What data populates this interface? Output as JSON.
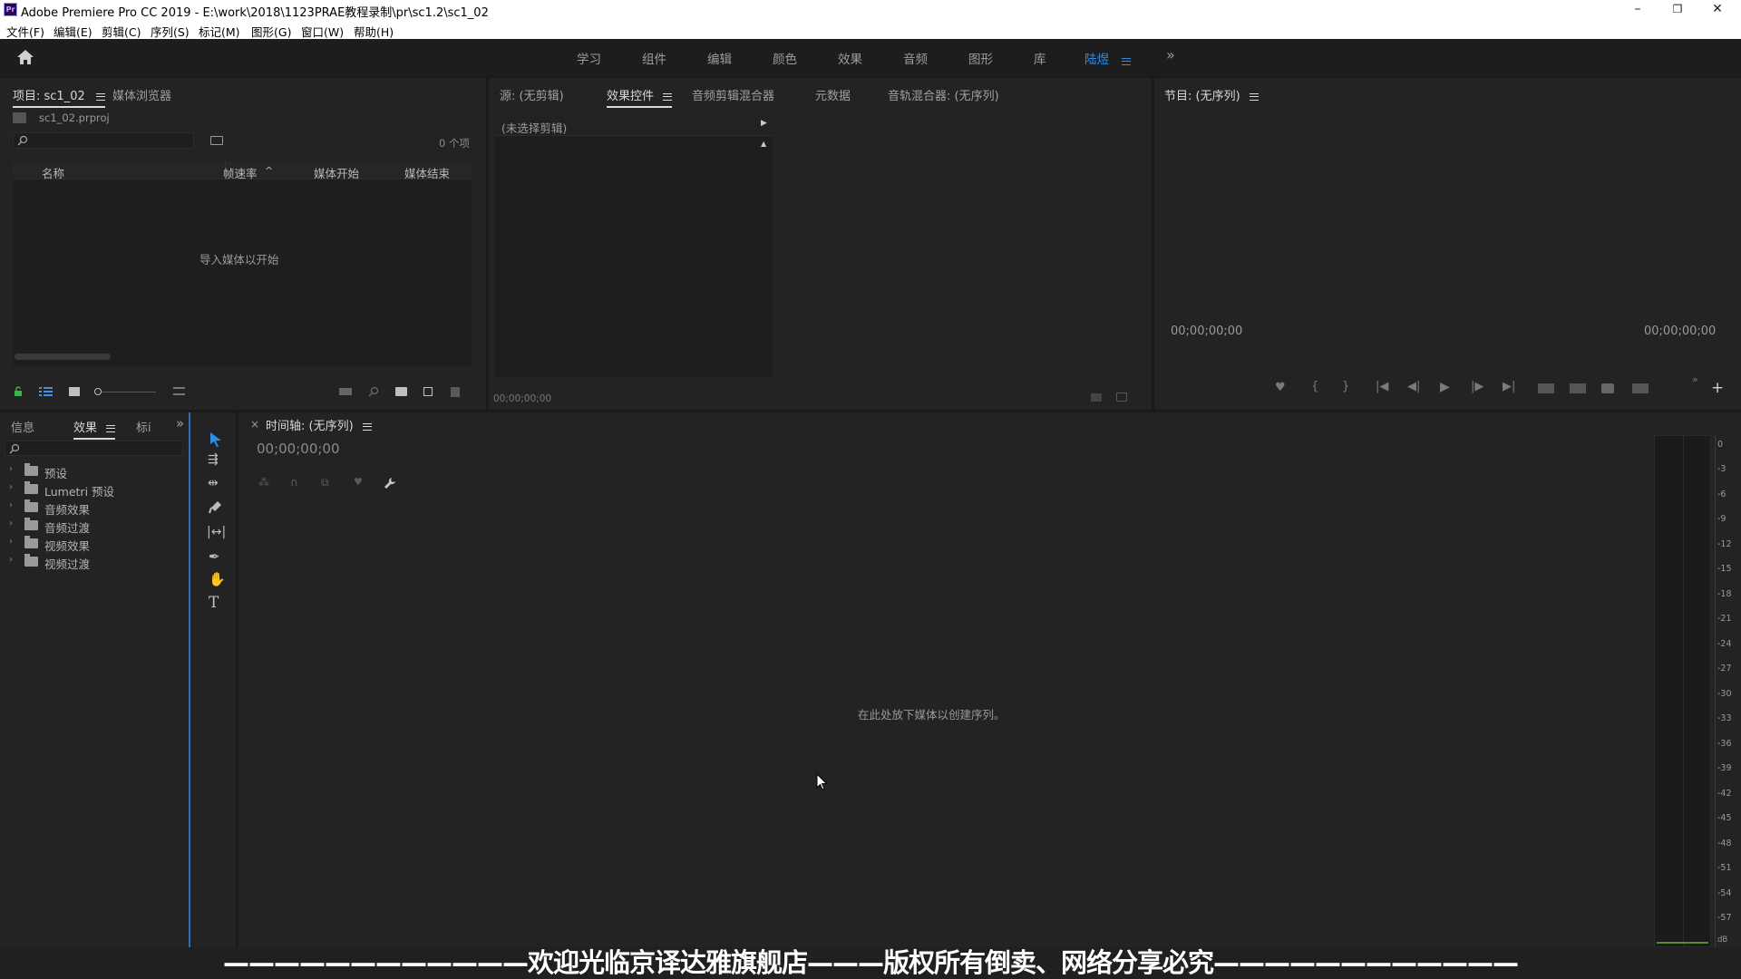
{
  "window": {
    "app_icon": "Pr",
    "title": "Adobe Premiere Pro CC 2019 - E:\\work\\2018\\1123PRAE教程录制\\pr\\sc1.2\\sc1_02",
    "minimize": "–",
    "restore": "❐",
    "close": "✕"
  },
  "menu": [
    "文件(F)",
    "编辑(E)",
    "剪辑(C)",
    "序列(S)",
    "标记(M)",
    "图形(G)",
    "窗口(W)",
    "帮助(H)"
  ],
  "workspaces": {
    "items": [
      "学习",
      "组件",
      "编辑",
      "颜色",
      "效果",
      "音频",
      "图形",
      "库",
      "陆煜"
    ],
    "active": "陆煜",
    "more": "»"
  },
  "project_panel": {
    "tabs": [
      "项目: sc1_02",
      "媒体浏览器"
    ],
    "file": "sc1_02.prproj",
    "item_count": "0 个项",
    "columns": [
      "名称",
      "帧速率",
      "媒体开始",
      "媒体结束"
    ],
    "sort_indicator": "^",
    "empty_message": "导入媒体以开始"
  },
  "source_panel": {
    "tabs": [
      "源: (无剪辑)",
      "效果控件",
      "音频剪辑混合器",
      "元数据",
      "音轨混合器: (无序列)"
    ],
    "no_clip": "(未选择剪辑)",
    "timecode": "00;00;00;00"
  },
  "program_panel": {
    "tab": "节目: (无序列)",
    "timecode_left": "00;00;00;00",
    "timecode_right": "00;00;00;00"
  },
  "effects_panel": {
    "tabs": [
      "信息",
      "效果",
      "标i"
    ],
    "more": "»",
    "items": [
      "预设",
      "Lumetri 预设",
      "音频效果",
      "音频过渡",
      "视频效果",
      "视频过渡"
    ]
  },
  "timeline": {
    "close": "×",
    "tab": "时间轴: (无序列)",
    "timecode": "00;00;00;00",
    "empty_message": "在此处放下媒体以创建序列。"
  },
  "audio_meter": {
    "ticks": [
      "0",
      "-3",
      "-6",
      "-9",
      "-12",
      "-15",
      "-18",
      "-21",
      "-24",
      "-27",
      "-30",
      "-33",
      "-36",
      "-39",
      "-42",
      "-45",
      "-48",
      "-51",
      "-54",
      "-57",
      "dB"
    ]
  },
  "watermark": "————————————欢迎光临京译达雅旗舰店———版权所有倒卖、网络分享必究————————————"
}
